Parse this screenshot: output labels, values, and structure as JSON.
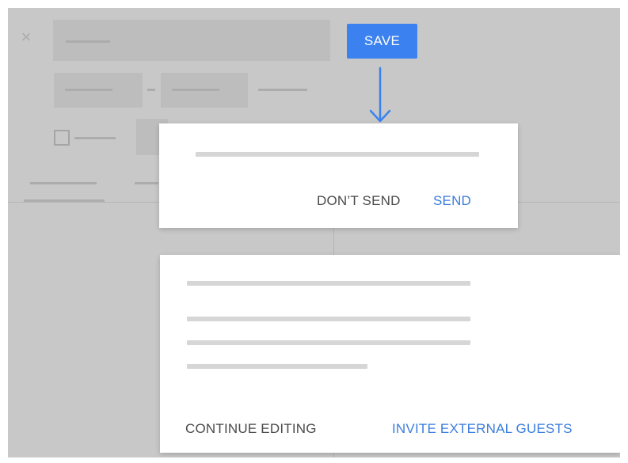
{
  "save_button": {
    "label": "SAVE",
    "color": "#3b82f0"
  },
  "arrow": {
    "icon": "arrow-down-icon",
    "color": "#3b82f0"
  },
  "background_editor": {
    "close_icon": "close-icon",
    "glyph": "×"
  },
  "send_dialog": {
    "dont_send_label": "DON’T SEND",
    "send_label": "SEND"
  },
  "external_guests_dialog": {
    "continue_editing_label": "CONTINUE EDITING",
    "invite_label": "INVITE EXTERNAL GUESTS"
  },
  "colors": {
    "accent": "#3b7ddd",
    "overlay": "#c8c8c8",
    "text": "#4a4a4a"
  }
}
